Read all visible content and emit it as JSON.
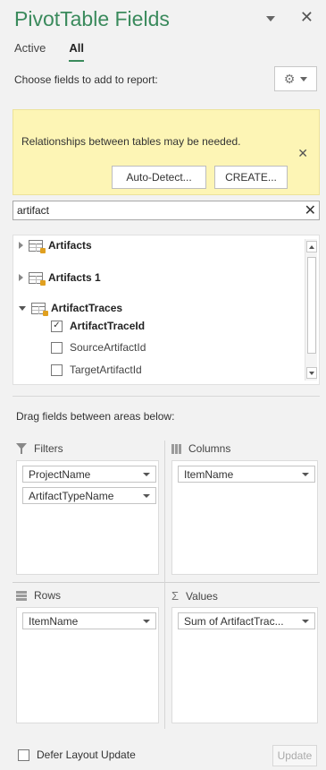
{
  "header": {
    "title": "PivotTable Fields",
    "tabs": [
      {
        "label": "Active"
      },
      {
        "label": "All"
      }
    ],
    "choose_label": "Choose fields to add to report:"
  },
  "notice": {
    "text": "Relationships between tables may be needed.",
    "auto_detect": "Auto-Detect...",
    "create": "CREATE..."
  },
  "search": {
    "value": "artifact"
  },
  "fields": {
    "tables": [
      {
        "name": "Artifacts",
        "expanded": false
      },
      {
        "name": "Artifacts 1",
        "expanded": false
      },
      {
        "name": "ArtifactTraces",
        "expanded": true
      }
    ],
    "items": [
      {
        "label": "ArtifactTraceId",
        "checked": true
      },
      {
        "label": "SourceArtifactId",
        "checked": false
      },
      {
        "label": "TargetArtifactId",
        "checked": false
      }
    ]
  },
  "areas": {
    "drag_label": "Drag fields between areas below:",
    "filters": {
      "label": "Filters",
      "items": [
        "ProjectName",
        "ArtifactTypeName"
      ]
    },
    "columns": {
      "label": "Columns",
      "items": [
        "ItemName"
      ]
    },
    "rows": {
      "label": "Rows",
      "items": [
        "ItemName"
      ]
    },
    "values": {
      "label": "Values",
      "items": [
        "Sum of ArtifactTrac..."
      ]
    }
  },
  "footer": {
    "defer_label": "Defer Layout Update",
    "update_label": "Update"
  },
  "colors": {
    "accent": "#3a8a5c",
    "notice_bg": "#fdf5b5"
  }
}
